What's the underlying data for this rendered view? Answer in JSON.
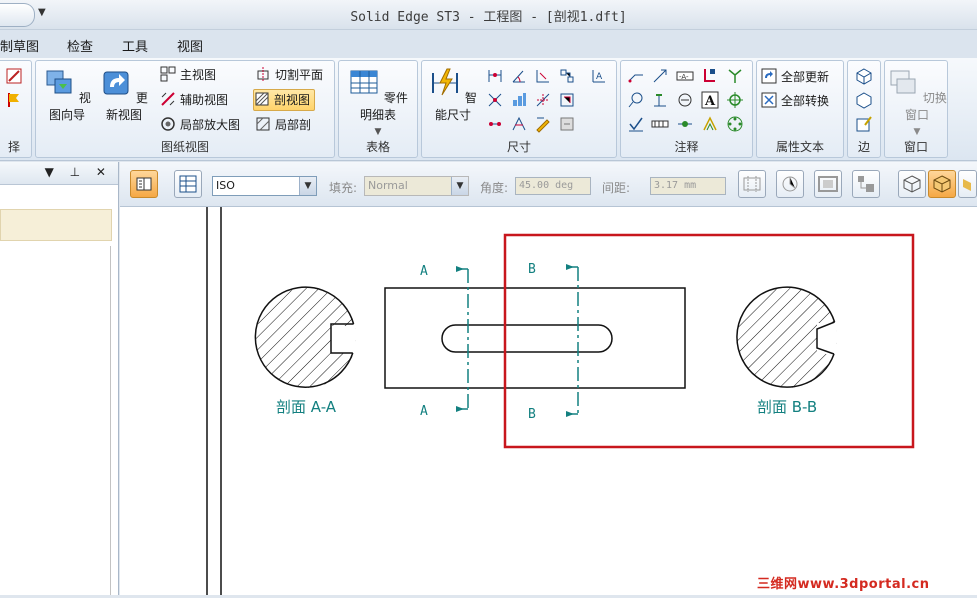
{
  "window": {
    "title": "Solid Edge ST3 - 工程图 - [剖视1.dft]"
  },
  "menu": {
    "tabs": [
      "制草图",
      "检查",
      "工具",
      "视图"
    ]
  },
  "ribbon": {
    "groups": {
      "partial_left": {
        "label": "择"
      },
      "drawing_views": {
        "label": "图纸视图",
        "view_wizard": "视图向导",
        "update_views": "更新视图",
        "principal_view": "主视图",
        "auxiliary_view": "辅助视图",
        "detail_view": "局部放大图",
        "cutting_plane": "切割平面",
        "section_view": "剖视图",
        "broken_out_section": "局部剖"
      },
      "tables": {
        "label": "表格",
        "parts_list": "零件明细表"
      },
      "dimension": {
        "label": "尺寸",
        "smart_dimension": "智能尺寸"
      },
      "annotation": {
        "label": "注释"
      },
      "property_text": {
        "label": "属性文本",
        "update_all": "全部更新",
        "convert_all": "全部转换"
      },
      "edges": {
        "label": "边"
      },
      "window": {
        "label": "窗口",
        "switch_window": "切换窗口"
      }
    }
  },
  "command_bar": {
    "standard": "ISO",
    "fill_label": "填充:",
    "fill_value": "Normal",
    "angle_label": "角度:",
    "angle_value": "45.00 deg",
    "spacing_label": "间距:",
    "spacing_value": "3.17 mm"
  },
  "drawing": {
    "cut_a": "A",
    "cut_b": "B",
    "section_aa": "剖面 A-A",
    "section_bb": "剖面 B-B",
    "line_color": "#111111",
    "annotation_color": "#138080",
    "highlight_color": "#c8161d"
  },
  "watermark": "三维网www.3dportal.cn"
}
